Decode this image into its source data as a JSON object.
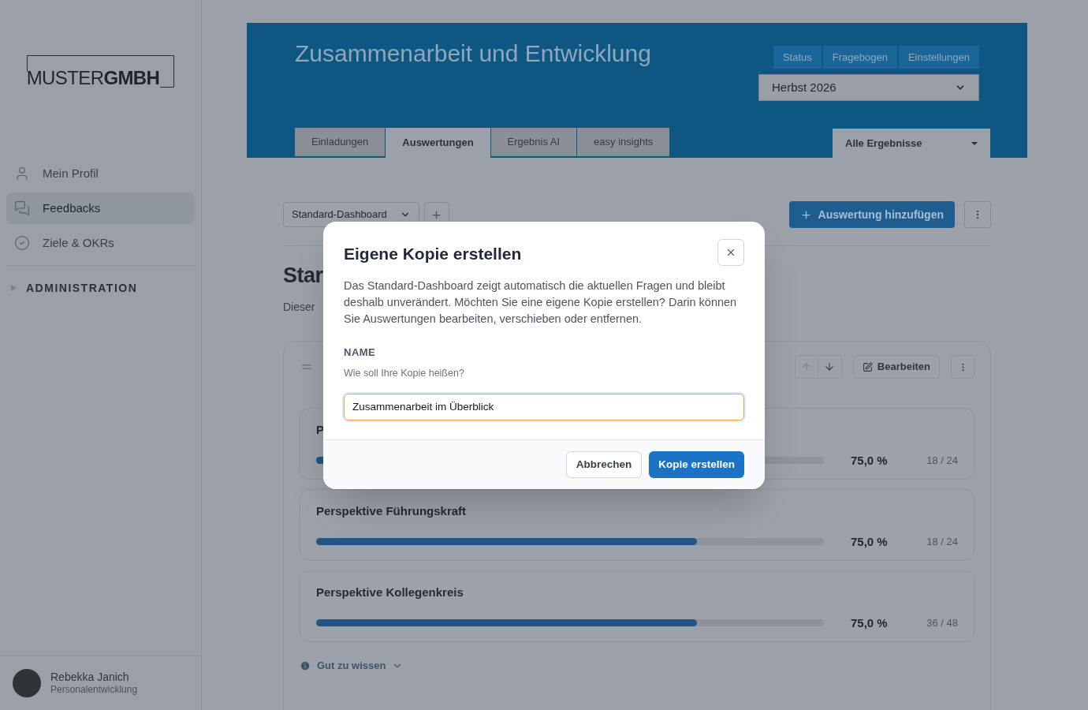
{
  "sidebar": {
    "logo": {
      "light": "MUSTER",
      "bold": "GMBH"
    },
    "items": [
      {
        "label": "Mein Profil",
        "selected": false
      },
      {
        "label": "Feedbacks",
        "selected": true
      },
      {
        "label": "Ziele & OKRs",
        "selected": false
      }
    ],
    "section": {
      "label": "ADMINISTRATION",
      "expanded": false
    },
    "user": {
      "name": "Rebekka Janich",
      "role": "Personalentwicklung"
    }
  },
  "header": {
    "title": "Zusammenarbeit und Entwicklung",
    "buttons": [
      "Status",
      "Fragebogen",
      "Einstellungen"
    ],
    "period_select": {
      "value": "Herbst 2026"
    },
    "tabs": [
      {
        "label": "Einladungen",
        "selected": false
      },
      {
        "label": "Auswertungen",
        "selected": true
      },
      {
        "label": "Ergebnis AI",
        "selected": false
      },
      {
        "label": "easy insights",
        "selected": false
      }
    ],
    "filter": {
      "value": "Alle Ergebnisse"
    }
  },
  "toolbar": {
    "dashboard_select": {
      "value": "Standard-Dashboard"
    },
    "add_button": "Auswertung hinzufügen"
  },
  "page": {
    "heading": "Star",
    "description": "Dieser"
  },
  "panel": {
    "edit_button": "Bearbeiten",
    "cards": [
      {
        "title": "P",
        "level": 0.75,
        "percent": "75,0 %",
        "count": "18 / 24"
      },
      {
        "title": "Perspektive Führungskraft",
        "level": 0.75,
        "percent": "75,0 %",
        "count": "18 / 24"
      },
      {
        "title": "Perspektive Kollegenkreis",
        "level": 0.75,
        "percent": "75,0 %",
        "count": "36 / 48"
      }
    ],
    "hint": {
      "label": "Gut zu wissen",
      "expanded": false
    }
  },
  "dialog": {
    "title": "Eigene Kopie erstellen",
    "text": "Das Standard-Dashboard zeigt automatisch die aktuellen Fragen und bleibt deshalb unverändert. Möchten Sie eine eigene Kopie erstellen? Darin können Sie Auswertungen bearbeiten, verschieben oder entfernen.",
    "field": {
      "label": "NAME",
      "help": "Wie soll Ihre Kopie heißen?",
      "value": "Zusammenarbeit im Überblick"
    },
    "buttons": [
      {
        "label": "Abbrechen",
        "kind": "secondary"
      },
      {
        "label": "Kopie erstellen",
        "kind": "primary"
      }
    ]
  }
}
